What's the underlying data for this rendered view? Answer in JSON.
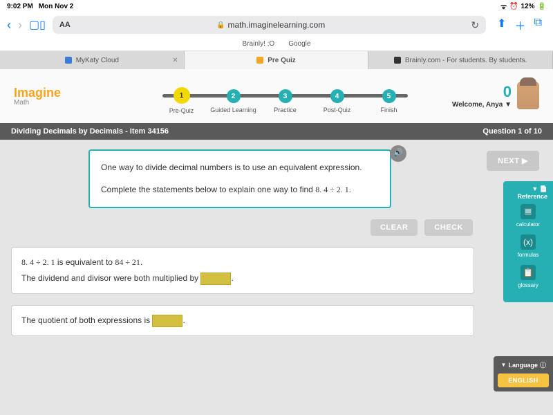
{
  "status": {
    "time": "9:02 PM",
    "date": "Mon Nov 2",
    "battery": "12%",
    "battery_icon": "▭"
  },
  "browser": {
    "url": "math.imaginelearning.com",
    "bookmarks": [
      "Brainly! ;O",
      "Google"
    ]
  },
  "tabs": [
    {
      "label": "MyKaty Cloud"
    },
    {
      "label": "Pre Quiz"
    },
    {
      "label": "Brainly.com - For students. By students."
    }
  ],
  "logo": {
    "main": "Imagine",
    "sub": "Math"
  },
  "steps": [
    {
      "num": "1",
      "label": "Pre-Quiz"
    },
    {
      "num": "2",
      "label": "Guided Learning"
    },
    {
      "num": "3",
      "label": "Practice"
    },
    {
      "num": "4",
      "label": "Post-Quiz"
    },
    {
      "num": "5",
      "label": "Finish"
    }
  ],
  "user": {
    "points": "0",
    "welcome": "Welcome, Anya ▼"
  },
  "bar": {
    "title": "Dividing Decimals by Decimals - Item 34156",
    "counter": "Question 1 of 10"
  },
  "instruction": {
    "line1": "One way to divide decimal numbers is to use an equivalent expression.",
    "line2_a": "Complete the statements below to explain one way to find ",
    "line2_math": "8. 4  ÷  2. 1",
    "line2_b": "."
  },
  "buttons": {
    "clear": "CLEAR",
    "check": "CHECK",
    "next": "NEXT ▶"
  },
  "q1": {
    "a": "8. 4  ÷  2. 1",
    "b": " is equivalent to ",
    "c": "84  ÷  21",
    "d": ".",
    "line2": "The dividend and divisor were both multiplied by ",
    "line2_end": "."
  },
  "q2": {
    "a": "The quotient of both expressions is ",
    "b": "."
  },
  "ref": {
    "header": "▼ 📄Reference",
    "calc": "calculator",
    "form": "formulas",
    "gloss": "glossary"
  },
  "lang": {
    "header": "Language",
    "btn": "ENGLISH"
  }
}
